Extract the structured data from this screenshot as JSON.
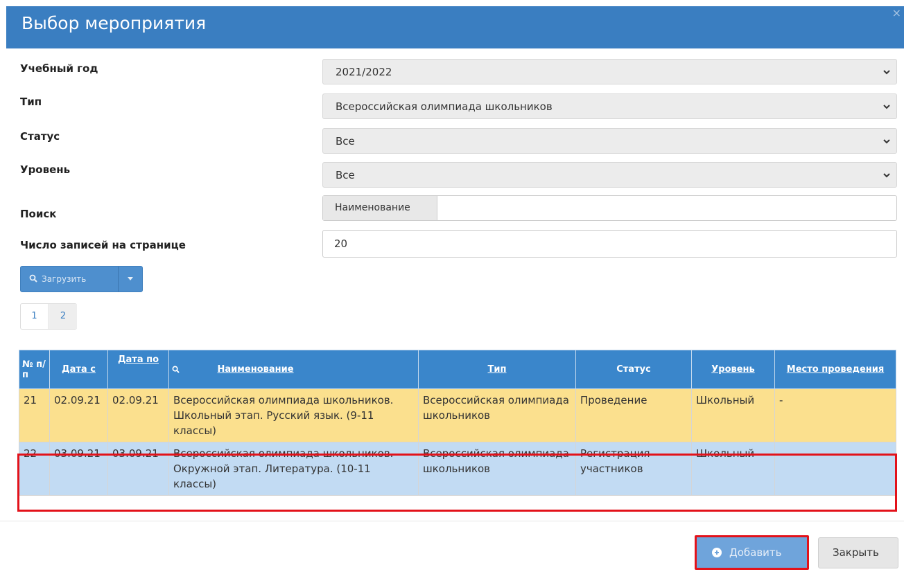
{
  "dialog": {
    "title": "Выбор мероприятия",
    "close_glyph": "×"
  },
  "form": {
    "year": {
      "label": "Учебный год",
      "value": "2021/2022"
    },
    "type": {
      "label": "Тип",
      "value": "Всероссийская олимпиада школьников"
    },
    "status": {
      "label": "Статус",
      "value": "Все"
    },
    "level": {
      "label": "Уровень",
      "value": "Все"
    },
    "search": {
      "label": "Поиск",
      "addon": "Наименование",
      "value": ""
    },
    "per_page": {
      "label": "Число записей на странице",
      "value": "20"
    }
  },
  "load_button": {
    "label": "Загрузить"
  },
  "pagination": {
    "pages": [
      "1",
      "2"
    ],
    "current": "1"
  },
  "table": {
    "headers": {
      "num": "№ п/п",
      "date_from": "Дата с",
      "date_to": "Дата по",
      "name": "Наименование",
      "type": "Тип",
      "status": "Статус",
      "level": "Уровень",
      "place": "Место проведения"
    },
    "rows": [
      {
        "num": "21",
        "date_from": "02.09.21",
        "date_to": "02.09.21",
        "name": "Всероссийская олимпиада школьников. Школьный этап. Русский язык. (9-11 классы)",
        "type": "Всероссийская олимпиада школьников",
        "status": "Проведение",
        "level": "Школьный",
        "place": "-"
      },
      {
        "num": "22",
        "date_from": "03.09.21",
        "date_to": "03.09.21",
        "name": "Всероссийская олимпиада школьников. Окружной этап. Литература. (10-11 классы)",
        "type": "Всероссийская олимпиада школьников",
        "status": "Регистрация участников",
        "level": "Школьный",
        "place": "-"
      }
    ]
  },
  "footer": {
    "add_label": "Добавить",
    "close_label": "Закрыть"
  },
  "colors": {
    "header": "#3a7ec1",
    "table_header": "#3a86cb",
    "row_active": "#fbe08e",
    "row_selected": "#c2dbf3",
    "highlight": "#e3121a"
  }
}
